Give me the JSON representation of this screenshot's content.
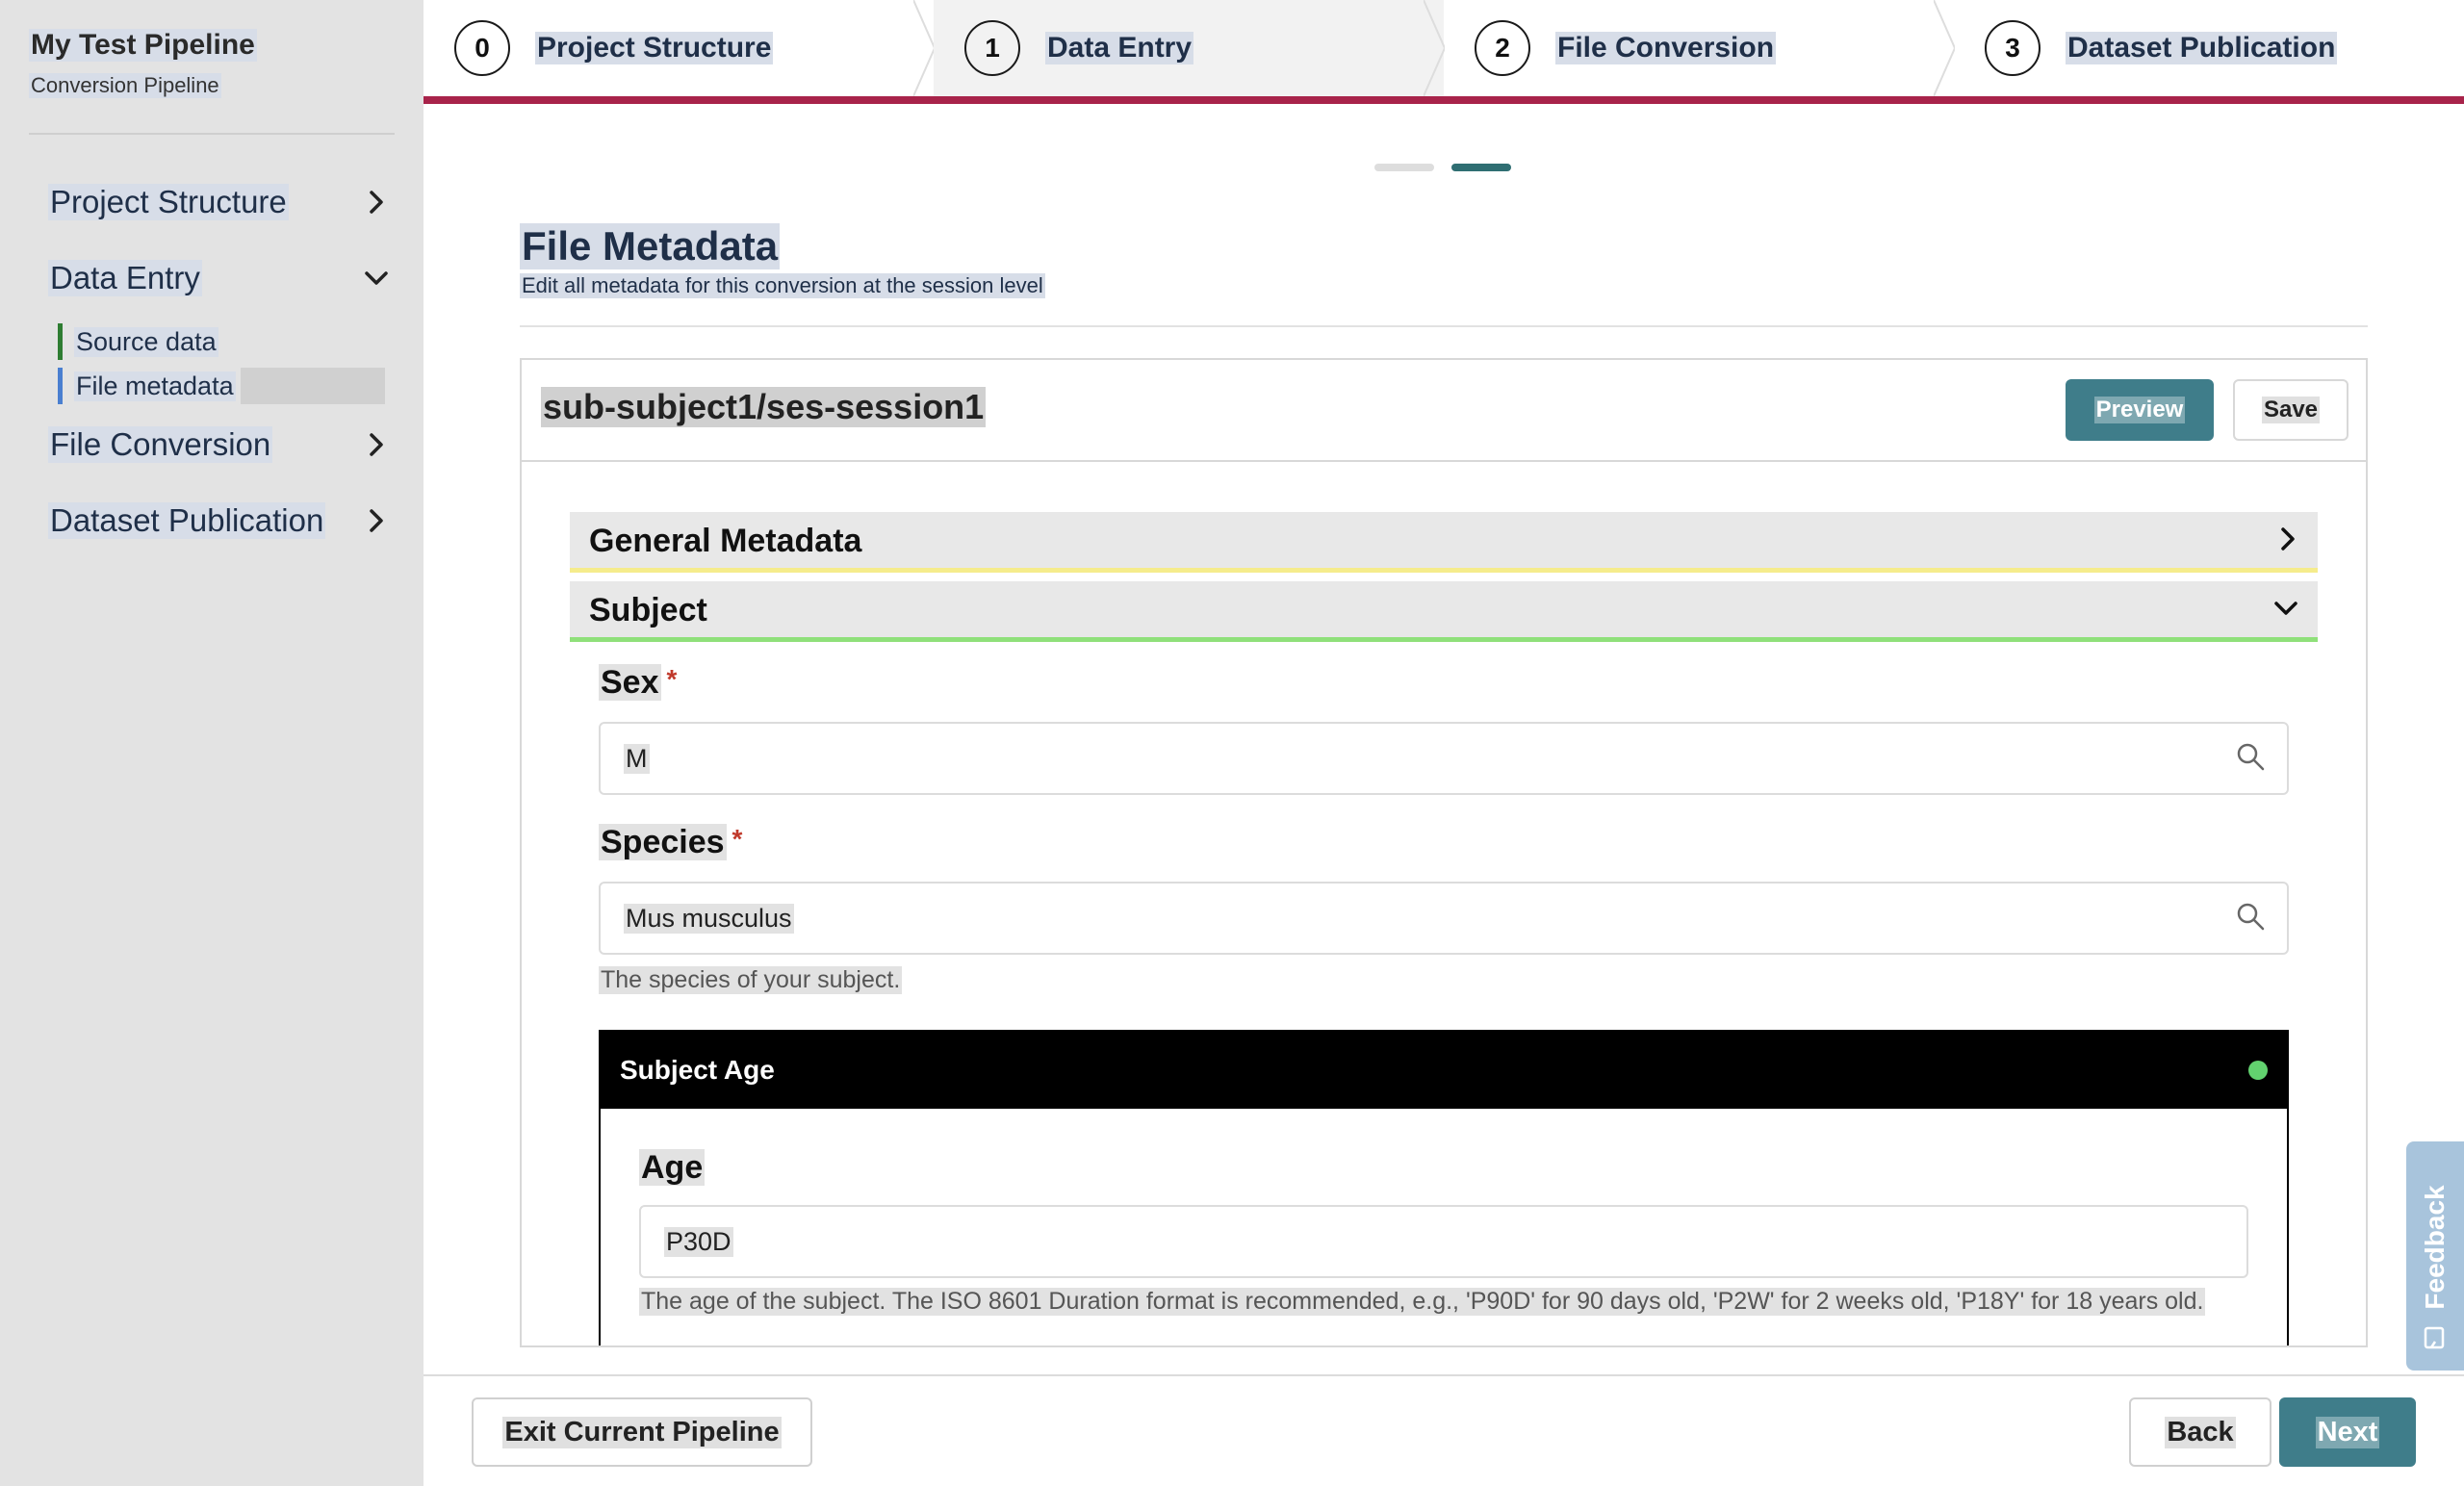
{
  "sidebar": {
    "title": "My Test Pipeline",
    "subtitle": "Conversion Pipeline",
    "items": [
      {
        "label": "Project Structure",
        "icon": "chevron-right-icon"
      },
      {
        "label": "Data Entry",
        "icon": "chevron-down-icon"
      },
      {
        "label": "File Conversion",
        "icon": "chevron-right-icon"
      },
      {
        "label": "Dataset Publication",
        "icon": "chevron-right-icon"
      }
    ],
    "subitems": [
      {
        "label": "Source data",
        "color": "#2e7d32"
      },
      {
        "label": "File metadata",
        "color": "#4a7fd0",
        "active": true
      }
    ]
  },
  "stepper": {
    "steps": [
      {
        "number": "0",
        "label": "Project Structure"
      },
      {
        "number": "1",
        "label": "Data Entry"
      },
      {
        "number": "2",
        "label": "File Conversion"
      },
      {
        "number": "3",
        "label": "Dataset Publication"
      }
    ],
    "accent": "#a8234a"
  },
  "pager": {
    "total": 2,
    "current": 2
  },
  "main": {
    "title": "File Metadata",
    "subtitle": "Edit all metadata for this conversion at the session level"
  },
  "panel": {
    "session": "sub-subject1/ses-session1",
    "preview_label": "Preview",
    "save_label": "Save",
    "accordions": [
      {
        "label": "General Metadata",
        "state": "collapsed",
        "color": "#f5ec8c"
      },
      {
        "label": "Subject",
        "state": "expanded",
        "color": "#8fe07a"
      }
    ],
    "fields": {
      "sex": {
        "label": "Sex",
        "value": "M",
        "required": true
      },
      "species": {
        "label": "Species",
        "value": "Mus musculus",
        "required": true,
        "help": "The species of your subject."
      }
    },
    "subject_age": {
      "header": "Subject Age",
      "status_color": "#62d26f",
      "age_label": "Age",
      "age_value": "P30D",
      "age_help": "The age of the subject. The ISO 8601 Duration format is recommended, e.g., 'P90D' for 90 days old, 'P2W' for 2 weeks old, 'P18Y' for 18 years old."
    }
  },
  "footer": {
    "exit_label": "Exit Current Pipeline",
    "back_label": "Back",
    "next_label": "Next"
  },
  "feedback": {
    "label": "Feedback"
  },
  "colors": {
    "primary": "#3f7d8a",
    "pager_active": "#2f6e72",
    "pager_inactive": "#dddddd"
  }
}
